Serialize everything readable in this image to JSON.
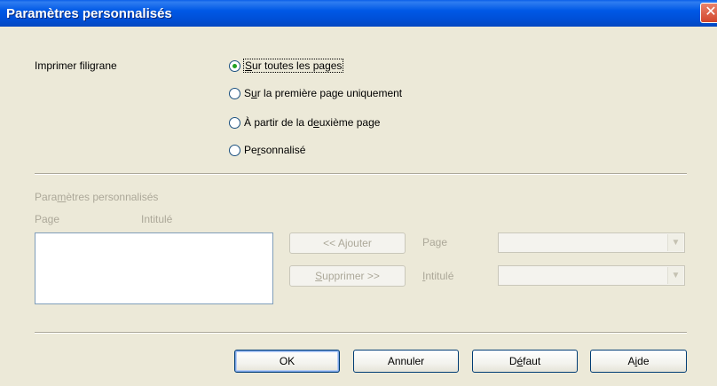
{
  "window": {
    "title": "Paramètres personnalisés",
    "close_glyph": "✕"
  },
  "watermark": {
    "label": "Imprimer filigrane",
    "options": [
      {
        "pre": "",
        "key": "S",
        "post": "ur toutes les pages",
        "checked": true
      },
      {
        "pre": "S",
        "key": "u",
        "post": "r la première page uniquement",
        "checked": false
      },
      {
        "pre": "À partir de la d",
        "key": "e",
        "post": "uxième page",
        "checked": false
      },
      {
        "pre": "Pe",
        "key": "r",
        "post": "sonnalisé",
        "checked": false
      }
    ]
  },
  "custom": {
    "section_pre": "Para",
    "section_key": "m",
    "section_post": "ètres personnalisés",
    "col_page": "Page",
    "col_title": "Intitulé",
    "add_button": "<< Ajouter",
    "remove_key": "S",
    "remove_post": "upprimer >>",
    "page_label": "Page",
    "title_key": "I",
    "title_post": "ntitulé",
    "combo_arrow": "▼"
  },
  "footer": {
    "ok": "OK",
    "cancel": "Annuler",
    "default_pre": "D",
    "default_key": "é",
    "default_post": "faut",
    "help_pre": "A",
    "help_key": "i",
    "help_post": "de"
  }
}
